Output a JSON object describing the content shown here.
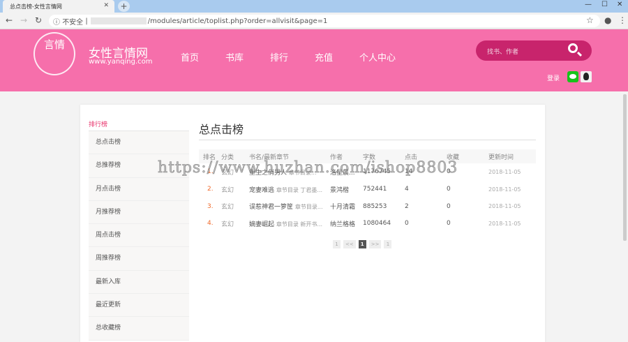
{
  "browser": {
    "tab_title": "总点击榜-女性言情网",
    "url_security": "不安全",
    "url_path": "/modules/article/toplist.php?order=allvisit&page=1"
  },
  "site": {
    "logo_text": "言情",
    "name": "女性言情网",
    "domain": "www.yanqing.com",
    "nav": [
      "首页",
      "书库",
      "排行",
      "充值",
      "个人中心"
    ],
    "search_placeholder": "找书、作者",
    "login": "登录"
  },
  "sidebar": {
    "title": "排行榜",
    "items": [
      "总点击榜",
      "总推荐榜",
      "月点击榜",
      "月推荐榜",
      "周点击榜",
      "周推荐榜",
      "最新入库",
      "最近更新",
      "总收藏榜"
    ]
  },
  "main": {
    "title": "总点击榜",
    "headers": [
      "排名",
      "分类",
      "书名/最新章节",
      "作者",
      "字数",
      "点击",
      "收藏",
      "更新时间"
    ],
    "rows": [
      {
        "rank": "1.",
        "cat": "玄幻",
        "book": "重生之俏男人",
        "chapter": "章节目录...",
        "author": "洛星晨...",
        "words": "1176745",
        "clicks": "14",
        "fav": "0",
        "date": "2018-11-05"
      },
      {
        "rank": "2.",
        "cat": "玄幻",
        "book": "宠妻难逃",
        "chapter": "章节目录 丁君墨...",
        "author": "景鸿楷",
        "words": "752441",
        "clicks": "4",
        "fav": "0",
        "date": "2018-11-05"
      },
      {
        "rank": "3.",
        "cat": "玄幻",
        "book": "误惹神君一箩筐",
        "chapter": "章节目录...",
        "author": "十月清霜",
        "words": "885253",
        "clicks": "2",
        "fav": "0",
        "date": "2018-11-05"
      },
      {
        "rank": "4.",
        "cat": "玄幻",
        "book": "嫡妻崛起",
        "chapter": "章节目录 新开书...",
        "author": "纳兰格格",
        "words": "1080464",
        "clicks": "0",
        "fav": "0",
        "date": "2018-11-05"
      }
    ],
    "pager": [
      "1",
      "<<",
      "1",
      ">>",
      "1"
    ]
  },
  "watermark": "https://www.huzhan.com/ishop8803"
}
